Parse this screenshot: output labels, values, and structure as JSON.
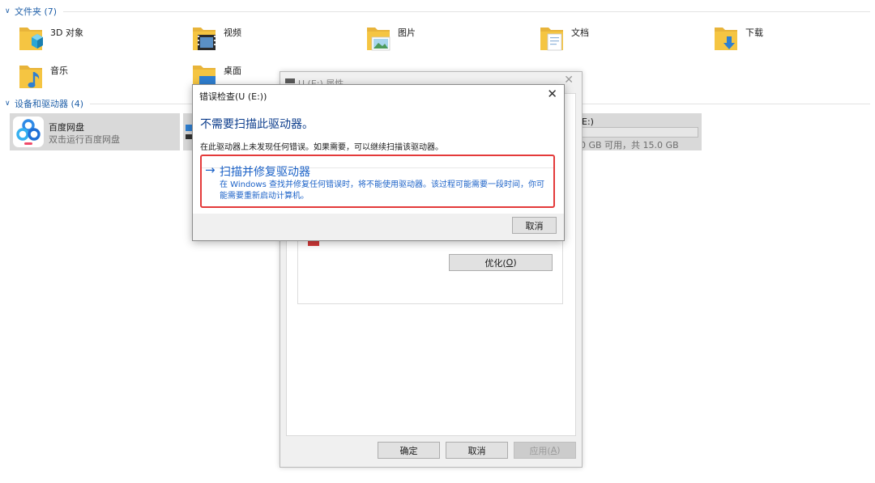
{
  "folders_section": {
    "chevron": "∨",
    "title": "文件夹 (7)"
  },
  "folders": [
    {
      "label": "3D 对象",
      "icon": "3d-objects-folder-icon"
    },
    {
      "label": "视频",
      "icon": "videos-folder-icon"
    },
    {
      "label": "图片",
      "icon": "pictures-folder-icon"
    },
    {
      "label": "文档",
      "icon": "documents-folder-icon"
    },
    {
      "label": "下载",
      "icon": "downloads-folder-icon"
    },
    {
      "label": "音乐",
      "icon": "music-folder-icon"
    },
    {
      "label": "桌面",
      "icon": "desktop-folder-icon"
    }
  ],
  "devices_section": {
    "chevron": "∨",
    "title": "设备和驱动器 (4)"
  },
  "drives": {
    "baidu": {
      "name": "百度网盘",
      "sub": "双击运行百度网盘",
      "icon": "baidu-netdisk-icon"
    },
    "usb": {
      "name": "E:)",
      "free": "0 GB 可用，共 15.0 GB"
    }
  },
  "properties_window": {
    "title": "U (E:) 属性",
    "close": "✕",
    "optimize_label": "优化(",
    "optimize_key": "O",
    "optimize_end": ")",
    "ok_label": "确定",
    "cancel_label": "取消",
    "apply_label": "应用(",
    "apply_key": "A",
    "apply_end": ")"
  },
  "error_check_dialog": {
    "title": "错误检查(U (E:))",
    "close": "✕",
    "heading": "不需要扫描此驱动器。",
    "description": "在此驱动器上未发现任何错误。如果需要，可以继续扫描该驱动器。",
    "action_arrow": "→",
    "action_title": "扫描并修复驱动器",
    "action_description": "在 Windows 查找并修复任何错误时，将不能使用驱动器。该过程可能需要一段时间，你可能需要重新启动计算机。",
    "cancel_label": "取消"
  },
  "colors": {
    "accent": "#1d63c8",
    "heading": "#0c3d8c",
    "highlight_border": "#e43a3a",
    "folder_yellow": "#f5c542"
  }
}
